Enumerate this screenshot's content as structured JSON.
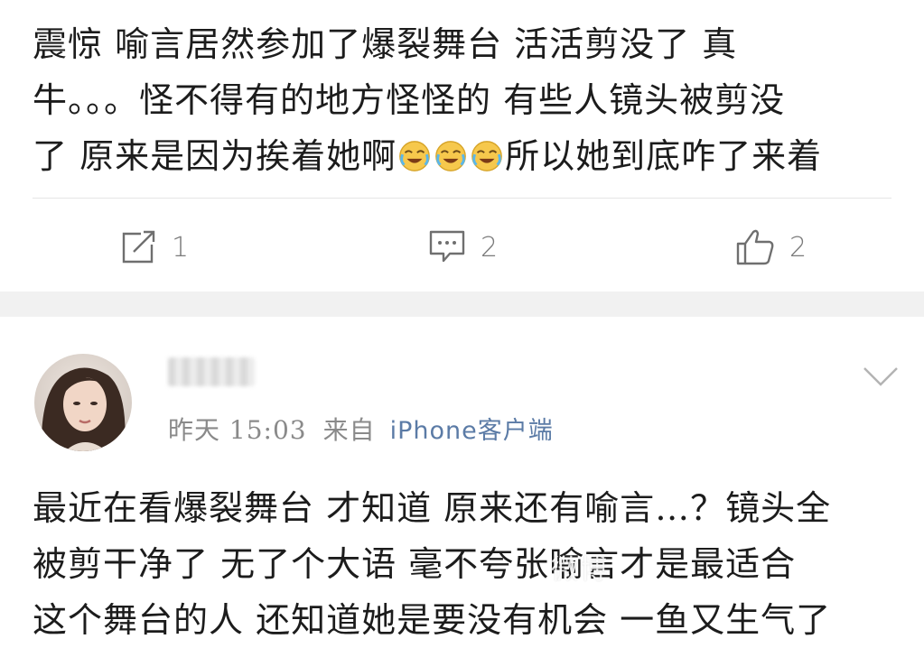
{
  "post": {
    "lines": [
      "震惊 喻言居然参加了爆裂舞台  活活剪没了 真",
      "牛。。。怪不得有的地方怪怪的 有些人镜头被剪没",
      "了 原来是因为挨着她啊",
      "所以她到底咋了来着"
    ],
    "emoji": "laughing-crying-emoji"
  },
  "actions": {
    "repost": {
      "icon": "repost-icon",
      "count": "1"
    },
    "comment": {
      "icon": "comment-icon",
      "count": "2"
    },
    "like": {
      "icon": "thumbs-up-icon",
      "count": "2"
    }
  },
  "comment": {
    "username": "",
    "time": "昨天 15:03",
    "from_label": "来自",
    "source": "iPhone客户端",
    "lines": [
      "最近在看爆裂舞台 才知道 原来还有喻言…？镜头全",
      "被剪干净了  无了个大语 毫不夸张喻言才是最适合",
      "这个舞台的人 还知道她是要没有机会 一鱼又生气了"
    ],
    "watermark": "微博"
  },
  "colors": {
    "text": "#1c1c1c",
    "muted": "#8a8a8a",
    "link": "#5b7ba6",
    "separator": "#f1f1f1"
  }
}
